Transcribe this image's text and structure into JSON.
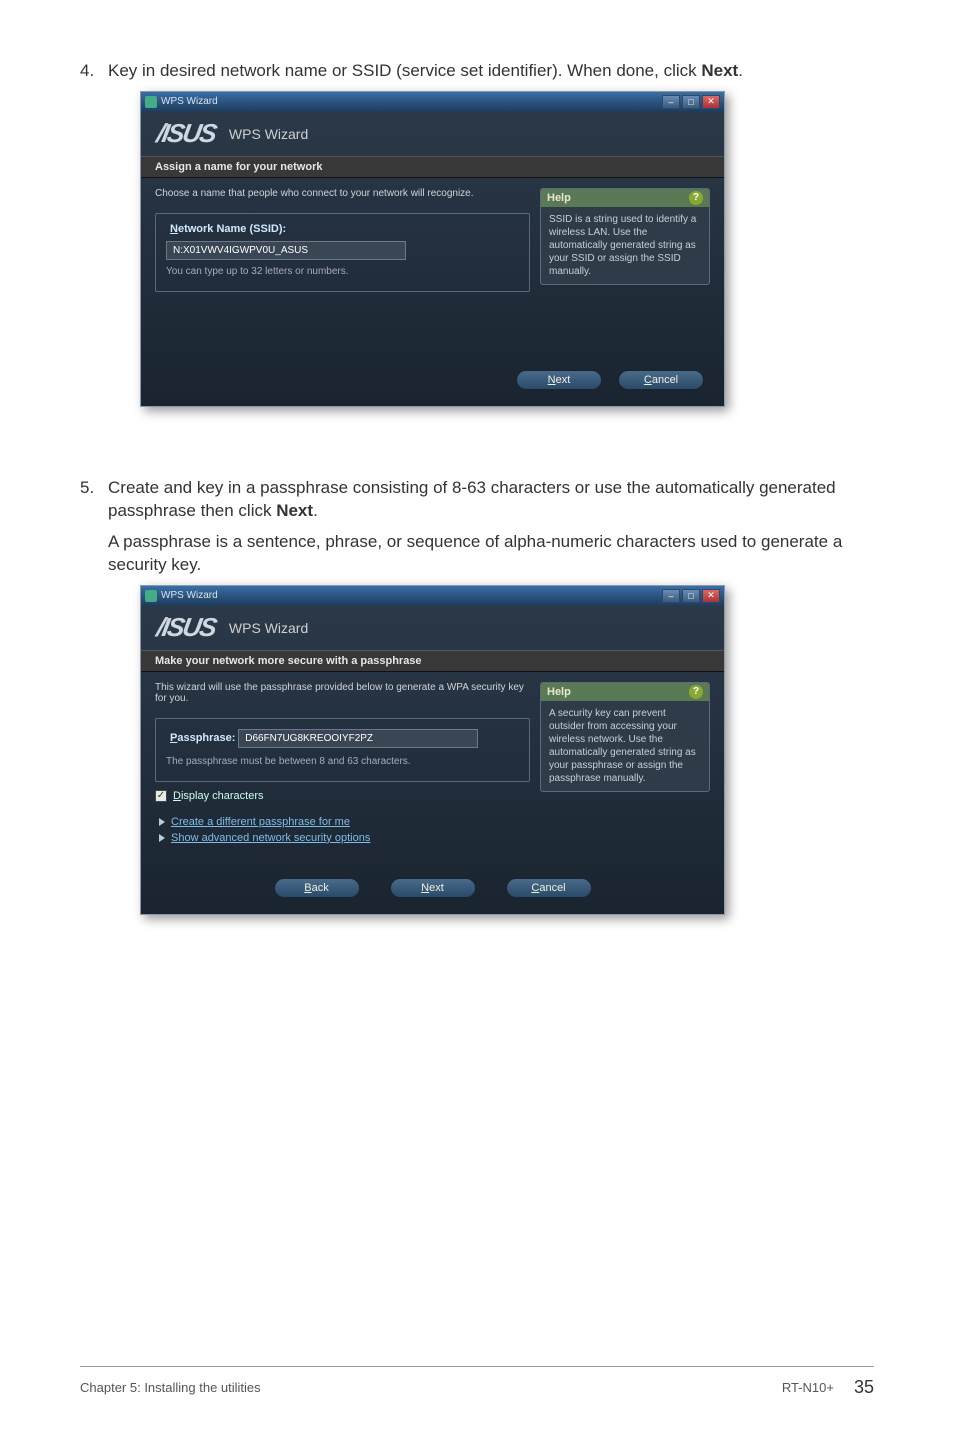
{
  "steps": {
    "s4_num": "4.",
    "s4_text_a": "Key in desired network name or SSID (service set identifier). When done, click ",
    "s4_text_b": "Next",
    "s4_text_c": ".",
    "s5_num": "5.",
    "s5_text_a": "Create and key in a passphrase consisting of 8-63 characters or use the automatically generated passphrase then click ",
    "s5_text_b": "Next",
    "s5_text_c": ".",
    "s5_sub": "A passphrase is a sentence, phrase, or sequence of alpha-numeric characters used to generate a security key."
  },
  "dialog1": {
    "title": "WPS Wizard",
    "brand": "WPS Wizard",
    "section": "Assign a name for your network",
    "intro": "Choose a name that people who connect to your network will recognize.",
    "fieldset_legend": "Network Name (SSID):",
    "input_value": "N:X01VWV4IGWPV0U_ASUS",
    "hint": "You can type up to 32 letters or numbers.",
    "help_title": "Help",
    "help_body": "SSID is a string used to identify a wireless LAN. Use the automatically generated string as your SSID or assign the SSID manually.",
    "btn_next": "Next",
    "btn_cancel": "Cancel"
  },
  "dialog2": {
    "title": "WPS Wizard",
    "brand": "WPS Wizard",
    "section": "Make your network more secure with a passphrase",
    "intro": "This wizard will use the passphrase provided below to generate a WPA security key for you.",
    "fieldset_legend": "Passphrase:",
    "input_value": "D66FN7UG8KREOOIYF2PZ",
    "hint": "The passphrase must be between 8 and 63 characters.",
    "checkbox_label": "Display characters",
    "link1": "Create a different passphrase for me",
    "link2": "Show advanced network security options",
    "help_title": "Help",
    "help_body": "A security key can prevent outsider from accessing your wireless network. Use the automatically generated string as your passphrase or assign the passphrase manually.",
    "btn_back": "Back",
    "btn_next": "Next",
    "btn_cancel": "Cancel"
  },
  "footer": {
    "left": "Chapter 5: Installing the utilities",
    "model": "RT-N10+",
    "page": "35"
  }
}
